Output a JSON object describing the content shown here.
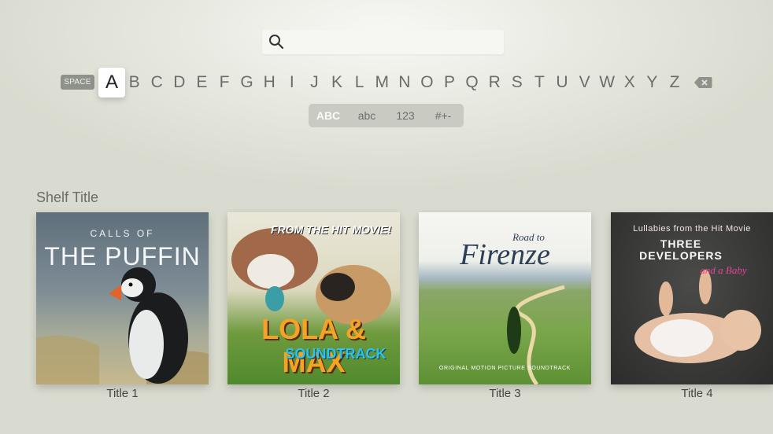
{
  "search": {
    "value": ""
  },
  "keyboard": {
    "space_label": "SPACE",
    "letters": [
      "A",
      "B",
      "C",
      "D",
      "E",
      "F",
      "G",
      "H",
      "I",
      "J",
      "K",
      "L",
      "M",
      "N",
      "O",
      "P",
      "Q",
      "R",
      "S",
      "T",
      "U",
      "V",
      "W",
      "X",
      "Y",
      "Z"
    ],
    "focused_letter": "A",
    "modes": [
      "ABC",
      "abc",
      "123",
      "#+-"
    ],
    "active_mode": "ABC"
  },
  "shelf": {
    "title": "Shelf Title",
    "items": [
      {
        "title": "Title 1",
        "art_lines": [
          "CALLS OF",
          "THE PUFFIN"
        ]
      },
      {
        "title": "Title 2",
        "art_lines": [
          "FROM THE HIT MOVIE!",
          "LOLA & MAX",
          "SOUNDTRACK"
        ]
      },
      {
        "title": "Title 3",
        "art_lines": [
          "Road to",
          "Firenze",
          "ORIGINAL MOTION PICTURE SOUNDTRACK"
        ]
      },
      {
        "title": "Title 4",
        "art_lines": [
          "Lullabies from the Hit Movie",
          "THREE",
          "DEVELOPERS",
          "and a Baby"
        ]
      }
    ]
  },
  "colors": {
    "focus_key_bg": "#ffffff",
    "key_text": "#6b6d67",
    "space_key_bg": "#8f918b"
  }
}
